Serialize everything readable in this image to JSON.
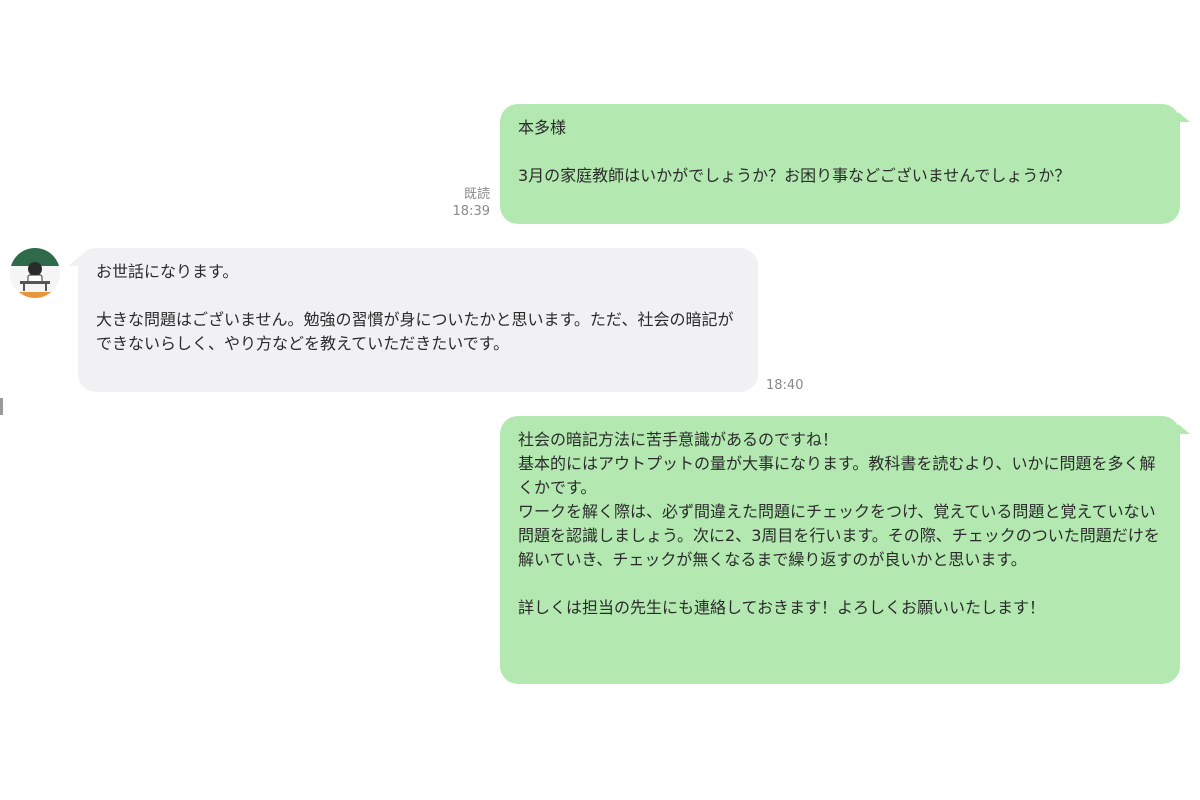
{
  "messages": [
    {
      "direction": "outgoing",
      "text": "本多様\n\n3月の家庭教師はいかがでしょうか？お困り事などございませんでしょうか？",
      "read_label": "既読",
      "time": "18:39"
    },
    {
      "direction": "incoming",
      "avatar_icon": "student-at-desk-avatar",
      "text": "お世話になります。\n\n大きな問題はございません。勉強の習慣が身についたかと思います。ただ、社会の暗記ができないらしく、やり方などを教えていただきたいです。",
      "time": "18:40"
    },
    {
      "direction": "outgoing",
      "text": "社会の暗記方法に苦手意識があるのですね！\n基本的にはアウトプットの量が大事になります。教科書を読むより、いかに問題を多く解くかです。\nワークを解く際は、必ず間違えた問題にチェックをつけ、覚えている問題と覚えていない問題を認識しましょう。次に2、3周目を行います。その際、チェックのついた問題だけを解いていき、チェックが無くなるまで繰り返すのが良いかと思います。\n\n詳しくは担当の先生にも連絡しておきます！よろしくお願いいたします！"
    }
  ],
  "colors": {
    "outgoing_bubble": "#b3e8b1",
    "incoming_bubble": "#f1f1f3",
    "meta_text": "#8a8a8a"
  }
}
